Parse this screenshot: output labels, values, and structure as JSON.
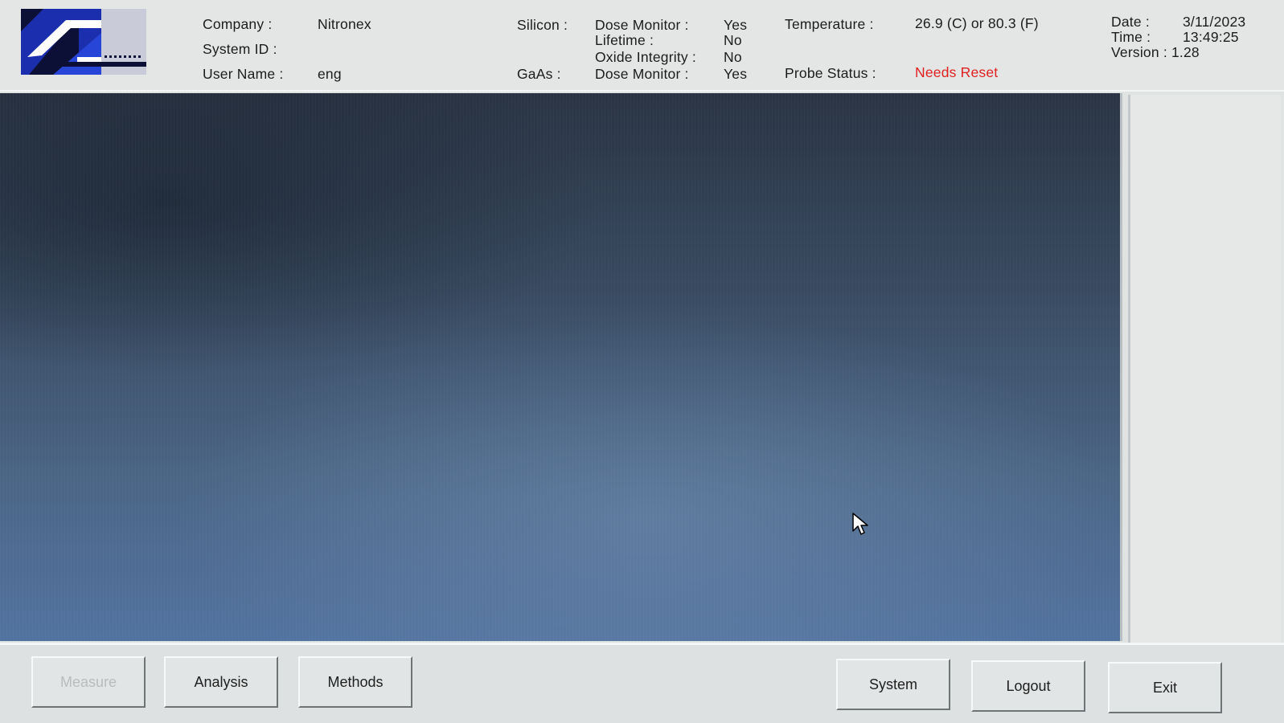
{
  "header": {
    "company_label": "Company :",
    "company_value": "Nitronex",
    "system_id_label": "System ID :",
    "system_id_value": "",
    "user_name_label": "User Name :",
    "user_name_value": "eng",
    "silicon_label": "Silicon :",
    "gaas_label": "GaAs :",
    "silicon": {
      "dose_monitor_label": "Dose Monitor :",
      "dose_monitor_value": "Yes",
      "lifetime_label": "Lifetime :",
      "lifetime_value": "No",
      "oxide_integrity_label": "Oxide Integrity :",
      "oxide_integrity_value": "No"
    },
    "gaas": {
      "dose_monitor_label": "Dose Monitor :",
      "dose_monitor_value": "Yes"
    },
    "temperature_label": "Temperature :",
    "temperature_value": "26.9 (C) or 80.3 (F)",
    "probe_status_label": "Probe Status :",
    "probe_status_value": "Needs Reset",
    "probe_status_color": "#e01f1f",
    "date_label": "Date :",
    "date_value": "3/11/2023",
    "time_label": "Time :",
    "time_value": "13:49:25",
    "version_label": "Version : 1.28"
  },
  "logo_icon": "company-logo-icon",
  "bottom_bar": {
    "measure_label": "Measure",
    "measure_disabled": true,
    "analysis_label": "Analysis",
    "methods_label": "Methods",
    "system_label": "System",
    "logout_label": "Logout",
    "exit_label": "Exit"
  },
  "colors": {
    "display_dark": "#2a3444",
    "display_light": "#5273a0",
    "panel": "#e3e6e5"
  }
}
